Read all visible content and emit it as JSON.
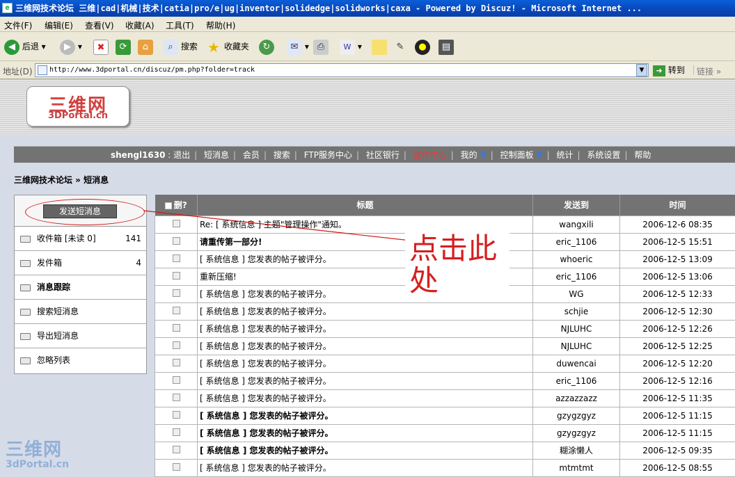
{
  "window": {
    "title": "三维网技术论坛 三维|cad|机械|技术|catia|pro/e|ug|inventor|solidedge|solidworks|caxa - Powered by Discuz! - Microsoft Internet ..."
  },
  "menu": [
    "文件(F)",
    "编辑(E)",
    "查看(V)",
    "收藏(A)",
    "工具(T)",
    "帮助(H)"
  ],
  "toolbar": {
    "back": "后退",
    "search": "搜索",
    "favorites": "收藏夹"
  },
  "address": {
    "label": "地址(D)",
    "url": "http://www.3dportal.cn/discuz/pm.php?folder=track",
    "go": "转到",
    "links": "链接"
  },
  "logo": {
    "line1": "三维网",
    "line2": "3DPortal.cn"
  },
  "nav": {
    "user": "shengl1630",
    "items": [
      {
        "label": "退出"
      },
      {
        "label": "短消息"
      },
      {
        "label": "会员"
      },
      {
        "label": "搜索"
      },
      {
        "label": "FTP服务中心"
      },
      {
        "label": "社区银行"
      },
      {
        "label": "宣传中心",
        "highlight": true
      },
      {
        "label": "我的",
        "dropdown": true
      },
      {
        "label": "控制面板",
        "dropdown": true
      },
      {
        "label": "统计"
      },
      {
        "label": "系统设置"
      },
      {
        "label": "帮助"
      }
    ]
  },
  "breadcrumb": "三维网技术论坛 » 短消息",
  "sidebar": {
    "send_button": "发送短消息",
    "items": [
      {
        "label": "收件箱 [未读 0]",
        "count": "141"
      },
      {
        "label": "发件箱",
        "count": "4"
      },
      {
        "label": "消息跟踪",
        "active": true
      },
      {
        "label": "搜索短消息"
      },
      {
        "label": "导出短消息"
      },
      {
        "label": "忽略列表"
      }
    ]
  },
  "table": {
    "headers": {
      "select": "删?",
      "subject": "标题",
      "to": "发送到",
      "time": "时间"
    },
    "rows": [
      {
        "subject": "Re: [ 系统信息 ] 主题\"管理操作\"通知。",
        "to": "wangxili",
        "time": "2006-12-6 08:35",
        "bold": false
      },
      {
        "subject": "请重传第一部分!",
        "to": "eric_1106",
        "time": "2006-12-5 15:51",
        "bold": true
      },
      {
        "subject": "[ 系统信息 ] 您发表的帖子被评分。",
        "to": "whoeric",
        "time": "2006-12-5 13:09",
        "bold": false
      },
      {
        "subject": "重新压缩!",
        "to": "eric_1106",
        "time": "2006-12-5 13:06",
        "bold": false
      },
      {
        "subject": "[ 系统信息 ] 您发表的帖子被评分。",
        "to": "WG",
        "time": "2006-12-5 12:33",
        "bold": false
      },
      {
        "subject": "[ 系统信息 ] 您发表的帖子被评分。",
        "to": "schjie",
        "time": "2006-12-5 12:30",
        "bold": false
      },
      {
        "subject": "[ 系统信息 ] 您发表的帖子被评分。",
        "to": "NJLUHC",
        "time": "2006-12-5 12:26",
        "bold": false
      },
      {
        "subject": "[ 系统信息 ] 您发表的帖子被评分。",
        "to": "NJLUHC",
        "time": "2006-12-5 12:25",
        "bold": false
      },
      {
        "subject": "[ 系统信息 ] 您发表的帖子被评分。",
        "to": "duwencai",
        "time": "2006-12-5 12:20",
        "bold": false
      },
      {
        "subject": "[ 系统信息 ] 您发表的帖子被评分。",
        "to": "eric_1106",
        "time": "2006-12-5 12:16",
        "bold": false
      },
      {
        "subject": "[ 系统信息 ] 您发表的帖子被评分。",
        "to": "azzazzazz",
        "time": "2006-12-5 11:35",
        "bold": false
      },
      {
        "subject": "[ 系统信息 ] 您发表的帖子被评分。",
        "to": "gzygzgyz",
        "time": "2006-12-5 11:15",
        "bold": true
      },
      {
        "subject": "[ 系统信息 ] 您发表的帖子被评分。",
        "to": "gzygzgyz",
        "time": "2006-12-5 11:15",
        "bold": true
      },
      {
        "subject": "[ 系统信息 ] 您发表的帖子被评分。",
        "to": "糊涂懒人",
        "time": "2006-12-5 09:35",
        "bold": true
      },
      {
        "subject": "[ 系统信息 ] 您发表的帖子被评分。",
        "to": "mtmtmt",
        "time": "2006-12-5 08:55",
        "bold": false
      }
    ]
  },
  "annotation": {
    "text": "点击此处",
    "color": "#d42020"
  },
  "watermark": {
    "line1": "三维网",
    "line2": "3dPortal.cn"
  }
}
